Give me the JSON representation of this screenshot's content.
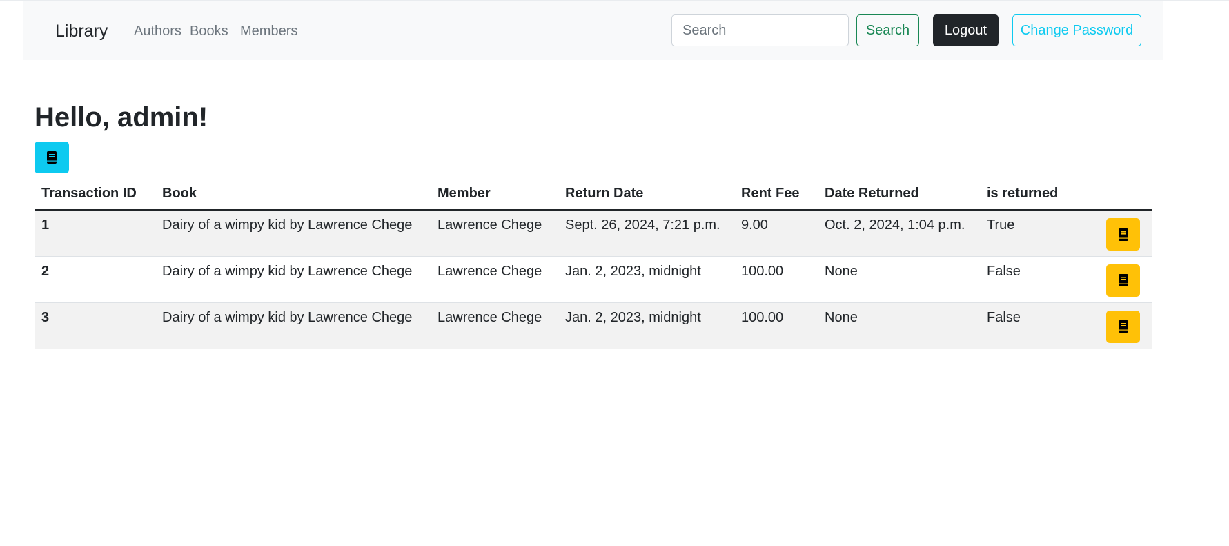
{
  "navbar": {
    "brand": "Library",
    "links": [
      {
        "label": "Authors"
      },
      {
        "label": "Books"
      },
      {
        "label": "Members"
      }
    ],
    "search_placeholder": "Search",
    "search_button": "Search",
    "logout_button": "Logout",
    "change_password_button": "Change Password"
  },
  "main": {
    "greeting": "Hello, admin!",
    "add_button_icon": "book-icon",
    "table": {
      "headers": [
        "Transaction ID",
        "Book",
        "Member",
        "Return Date",
        "Rent Fee",
        "Date Returned",
        "is returned"
      ],
      "rows": [
        {
          "id": "1",
          "book": "Dairy of a wimpy kid by Lawrence Chege",
          "member": "Lawrence Chege",
          "return_date": "Sept. 26, 2024, 7:21 p.m.",
          "rent_fee": "9.00",
          "date_returned": "Oct. 2, 2024, 1:04 p.m.",
          "is_returned": "True"
        },
        {
          "id": "2",
          "book": "Dairy of a wimpy kid by Lawrence Chege",
          "member": "Lawrence Chege",
          "return_date": "Jan. 2, 2023, midnight",
          "rent_fee": "100.00",
          "date_returned": "None",
          "is_returned": "False"
        },
        {
          "id": "3",
          "book": "Dairy of a wimpy kid by Lawrence Chege",
          "member": "Lawrence Chege",
          "return_date": "Jan. 2, 2023, midnight",
          "rent_fee": "100.00",
          "date_returned": "None",
          "is_returned": "False"
        }
      ],
      "row_action_icon": "book-icon"
    }
  },
  "colors": {
    "navbar_bg": "#f8f9fa",
    "success": "#198754",
    "dark": "#212529",
    "info": "#0dcaf0",
    "warning": "#ffc107",
    "stripe": "#f2f2f2"
  }
}
